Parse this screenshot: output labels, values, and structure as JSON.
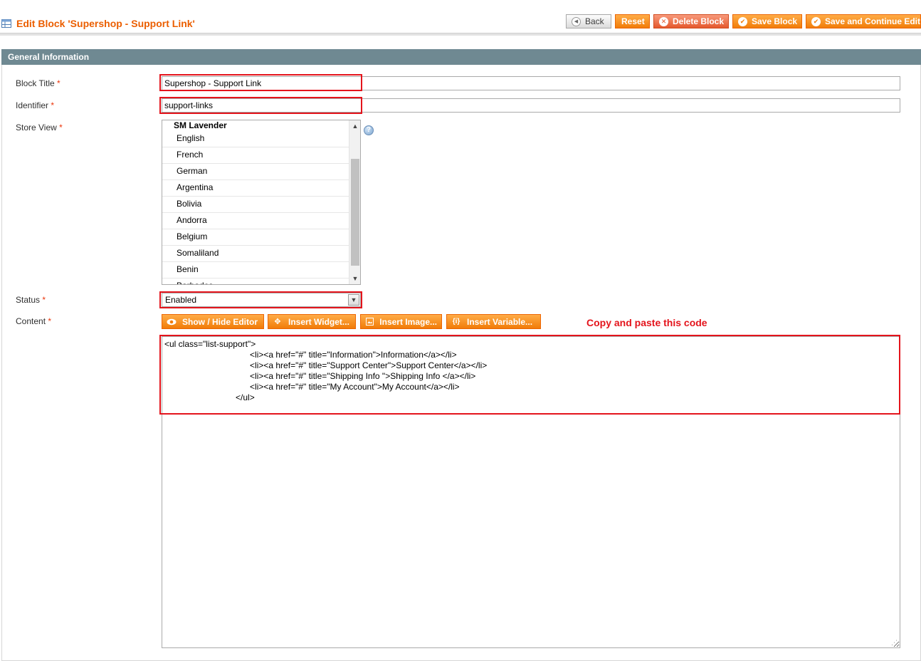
{
  "header": {
    "title": "Edit Block 'Supershop - Support Link'",
    "buttons": {
      "back": "Back",
      "reset": "Reset",
      "delete": "Delete Block",
      "save": "Save Block",
      "save_continue": "Save and Continue Edit"
    }
  },
  "section": {
    "title": "General Information"
  },
  "form": {
    "block_title": {
      "label": "Block Title",
      "required": "*",
      "value": "Supershop - Support Link"
    },
    "identifier": {
      "label": "Identifier",
      "required": "*",
      "value": "support-links"
    },
    "store_view": {
      "label": "Store View",
      "required": "*",
      "group": "SM Lavender",
      "options": [
        "English",
        "French",
        "German",
        "Argentina",
        "Bolivia",
        "Andorra",
        "Belgium",
        "Somaliland",
        "Benin",
        "Barbados"
      ],
      "help": "?"
    },
    "status": {
      "label": "Status",
      "required": "*",
      "value": "Enabled"
    },
    "content": {
      "label": "Content",
      "required": "*",
      "buttons": {
        "show_hide": "Show / Hide Editor",
        "insert_widget": "Insert Widget...",
        "insert_image": "Insert Image...",
        "insert_variable": "Insert Variable..."
      },
      "note": "Copy and paste this code",
      "value": "<ul class=\"list-support\">\n                                    <li><a href=\"#\" title=\"Information\">Information</a></li>\n                                    <li><a href=\"#\" title=\"Support Center\">Support Center</a></li>\n                                    <li><a href=\"#\" title=\"Shipping Info \">Shipping Info </a></li>\n                                    <li><a href=\"#\" title=\"My Account\">My Account</a></li>\n                              </ul>"
    }
  },
  "colors": {
    "accent": "#eb5e00",
    "highlight": "#e4141c",
    "section_bar": "#6f8992",
    "button": "#f17c08"
  }
}
